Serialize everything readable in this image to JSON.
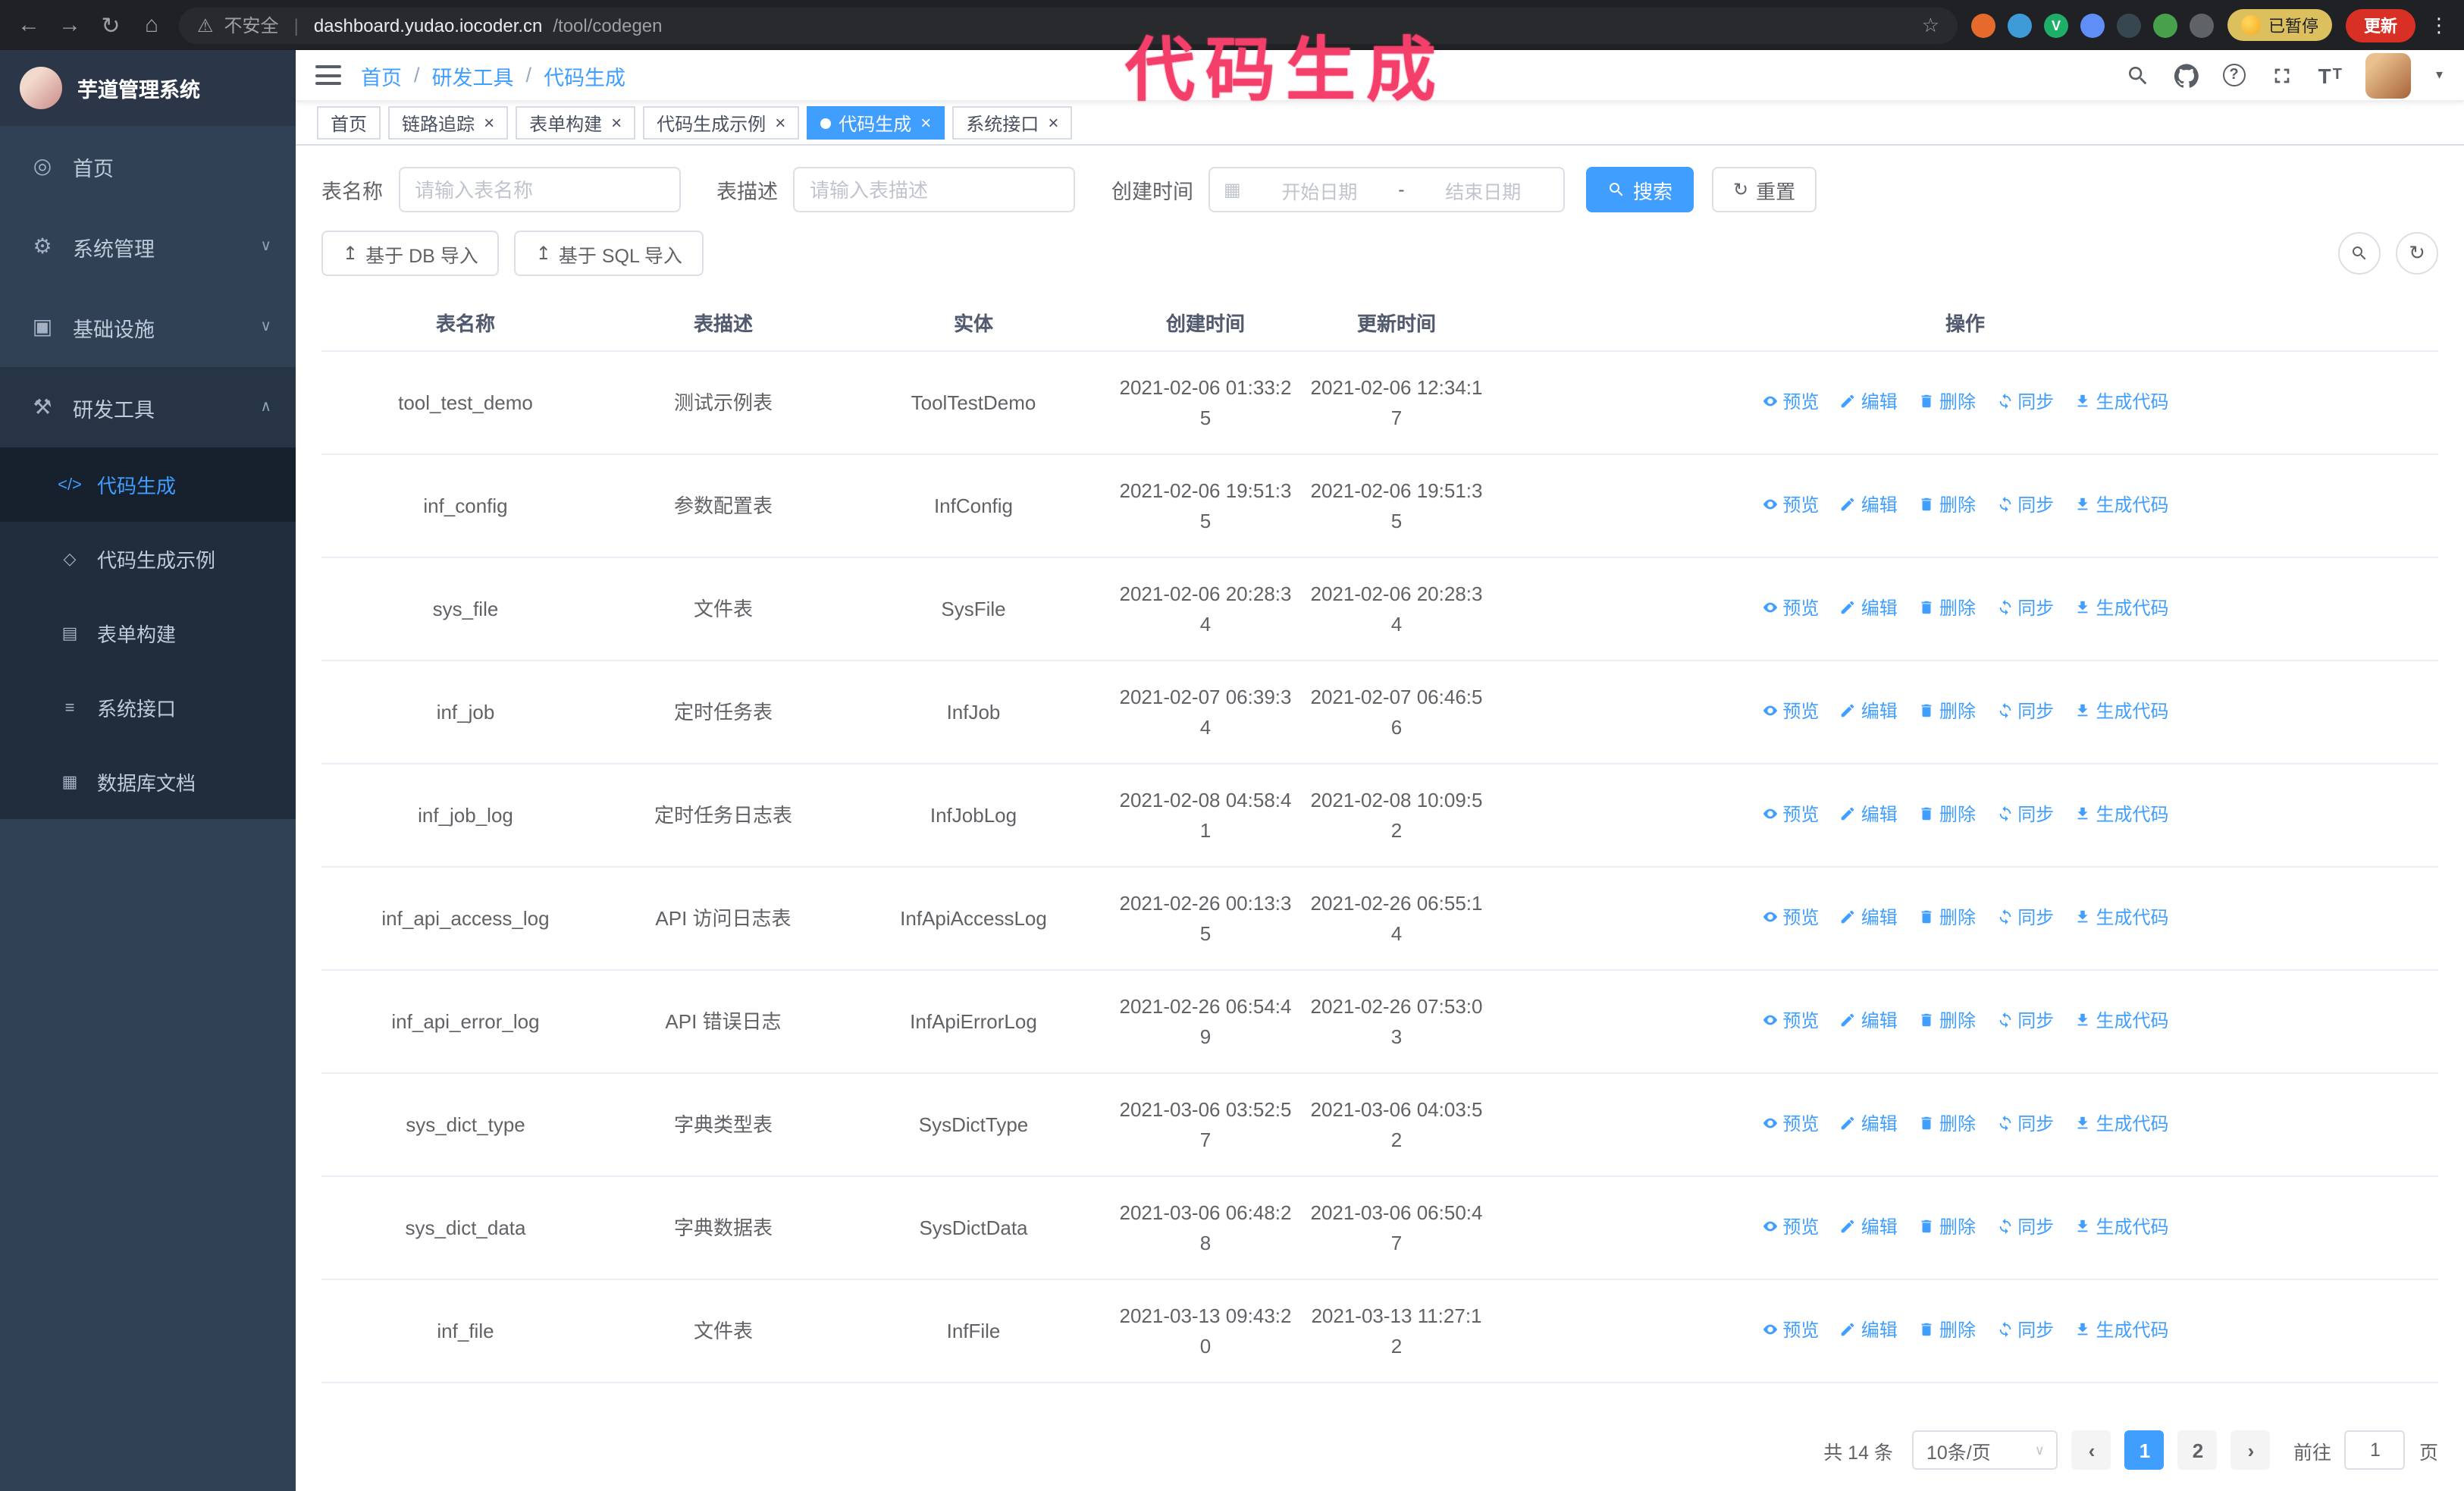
{
  "browser": {
    "security_warning": "不安全",
    "url_host": "dashboard.yudao.iocoder.cn",
    "url_path": "/tool/codegen",
    "profile_chip": "已暂停",
    "update_button": "更新",
    "extensions": [
      {
        "name": "fox-extension-icon",
        "color": "#e66a2c",
        "letter": ""
      },
      {
        "name": "drop-extension-icon",
        "color": "#3f9bd8",
        "letter": ""
      },
      {
        "name": "v-extension-icon",
        "color": "#1fae68",
        "letter": "V"
      },
      {
        "name": "people-extension-icon",
        "color": "#5f8ef7",
        "letter": ""
      },
      {
        "name": "screenshot-extension-icon",
        "color": "#37474f",
        "letter": ""
      },
      {
        "name": "leaf-extension-icon",
        "color": "#47a04b",
        "letter": ""
      },
      {
        "name": "puzzle-icon",
        "color": "#5f6368",
        "letter": ""
      }
    ]
  },
  "annotation": {
    "label": "代码生成",
    "color": "#f43f6b"
  },
  "glyphs": {
    "back": "←",
    "forward": "→",
    "reload": "↻",
    "home": "⌂",
    "warning": "⚠",
    "divider": "|",
    "star": "☆",
    "kebab": "⋮",
    "caret_down": "▾",
    "close": "×",
    "help": "?",
    "fontsize": "T",
    "calendar": "▦",
    "range_sep": "-",
    "reset": "↻",
    "refresh": "↻",
    "upload": "↥",
    "select_caret": "∨",
    "prev": "‹",
    "next": "›"
  },
  "sidebar": {
    "logo_title": "芋道管理系统",
    "items": [
      {
        "name": "sidebar-item-home",
        "icon_name": "dashboard-icon",
        "glyph": "◎",
        "label": "首页",
        "chevron": false,
        "chevron_glyph": ""
      },
      {
        "name": "sidebar-item-system",
        "icon_name": "gear-icon",
        "glyph": "⚙",
        "label": "系统管理",
        "chevron": true,
        "chevron_glyph": "∨"
      },
      {
        "name": "sidebar-item-infra",
        "icon_name": "monitor-icon",
        "glyph": "▣",
        "label": "基础设施",
        "chevron": true,
        "chevron_glyph": "∨"
      },
      {
        "name": "sidebar-item-devtools",
        "icon_name": "tools-icon",
        "glyph": "⚒",
        "label": "研发工具",
        "chevron": true,
        "chevron_glyph": "∧",
        "expanded": true
      }
    ],
    "sub_items": [
      {
        "name": "sidebar-item-codegen",
        "icon_name": "code-icon",
        "glyph": "</>",
        "label": "代码生成",
        "active": true
      },
      {
        "name": "sidebar-item-codegen-example",
        "icon_name": "shield-icon",
        "glyph": "◇",
        "label": "代码生成示例",
        "active": false
      },
      {
        "name": "sidebar-item-form-builder",
        "icon_name": "form-icon",
        "glyph": "▤",
        "label": "表单构建",
        "active": false
      },
      {
        "name": "sidebar-item-api",
        "icon_name": "list-icon",
        "glyph": "≡",
        "label": "系统接口",
        "active": false
      },
      {
        "name": "sidebar-item-db-doc",
        "icon_name": "grid-icon",
        "glyph": "▦",
        "label": "数据库文档",
        "active": false
      }
    ]
  },
  "topbar": {
    "breadcrumb": [
      {
        "name": "breadcrumb-home",
        "label": "首页",
        "sep": "/"
      },
      {
        "name": "breadcrumb-devtools",
        "label": "研发工具",
        "sep": "/"
      },
      {
        "name": "breadcrumb-codegen",
        "label": "代码生成",
        "sep": ""
      }
    ]
  },
  "tabs": [
    {
      "name": "tab-home",
      "label": "首页",
      "closable": false,
      "active": false
    },
    {
      "name": "tab-trace",
      "label": "链路追踪",
      "closable": true,
      "active": false
    },
    {
      "name": "tab-form-builder",
      "label": "表单构建",
      "closable": true,
      "active": false
    },
    {
      "name": "tab-codegen-example",
      "label": "代码生成示例",
      "closable": true,
      "active": false
    },
    {
      "name": "tab-codegen",
      "label": "代码生成",
      "closable": true,
      "active": true
    },
    {
      "name": "tab-api",
      "label": "系统接口",
      "closable": true,
      "active": false
    }
  ],
  "filters": {
    "table_name_label": "表名称",
    "table_name_placeholder": "请输入表名称",
    "table_desc_label": "表描述",
    "table_desc_placeholder": "请输入表描述",
    "create_time_label": "创建时间",
    "start_date_placeholder": "开始日期",
    "end_date_placeholder": "结束日期",
    "search_button": "搜索",
    "reset_button": "重置"
  },
  "toolbar": {
    "import_db_label": "基于 DB 导入",
    "import_sql_label": "基于 SQL 导入"
  },
  "table": {
    "columns": [
      "表名称",
      "表描述",
      "实体",
      "创建时间",
      "更新时间",
      "操作"
    ],
    "actions": [
      "预览",
      "编辑",
      "删除",
      "同步",
      "生成代码"
    ],
    "rows": [
      {
        "name": "tool_test_demo",
        "desc": "测试示例表",
        "entity": "ToolTestDemo",
        "created": "2021-02-06 01:33:25",
        "updated": "2021-02-06 12:34:17"
      },
      {
        "name": "inf_config",
        "desc": "参数配置表",
        "entity": "InfConfig",
        "created": "2021-02-06 19:51:35",
        "updated": "2021-02-06 19:51:35"
      },
      {
        "name": "sys_file",
        "desc": "文件表",
        "entity": "SysFile",
        "created": "2021-02-06 20:28:34",
        "updated": "2021-02-06 20:28:34"
      },
      {
        "name": "inf_job",
        "desc": "定时任务表",
        "entity": "InfJob",
        "created": "2021-02-07 06:39:34",
        "updated": "2021-02-07 06:46:56"
      },
      {
        "name": "inf_job_log",
        "desc": "定时任务日志表",
        "entity": "InfJobLog",
        "created": "2021-02-08 04:58:41",
        "updated": "2021-02-08 10:09:52"
      },
      {
        "name": "inf_api_access_log",
        "desc": "API 访问日志表",
        "entity": "InfApiAccessLog",
        "created": "2021-02-26 00:13:35",
        "updated": "2021-02-26 06:55:14"
      },
      {
        "name": "inf_api_error_log",
        "desc": "API 错误日志",
        "entity": "InfApiErrorLog",
        "created": "2021-02-26 06:54:49",
        "updated": "2021-02-26 07:53:03"
      },
      {
        "name": "sys_dict_type",
        "desc": "字典类型表",
        "entity": "SysDictType",
        "created": "2021-03-06 03:52:57",
        "updated": "2021-03-06 04:03:52"
      },
      {
        "name": "sys_dict_data",
        "desc": "字典数据表",
        "entity": "SysDictData",
        "created": "2021-03-06 06:48:28",
        "updated": "2021-03-06 06:50:47"
      },
      {
        "name": "inf_file",
        "desc": "文件表",
        "entity": "InfFile",
        "created": "2021-03-13 09:43:20",
        "updated": "2021-03-13 11:27:12"
      }
    ]
  },
  "pagination": {
    "total_label": "共 14 条",
    "page_size_label": "10条/页",
    "pages": [
      {
        "name": "page-1-button",
        "label": "1",
        "active": true
      },
      {
        "name": "page-2-button",
        "label": "2",
        "active": false
      }
    ],
    "goto_label": "前往",
    "goto_value": "1",
    "unit_label": "页"
  }
}
